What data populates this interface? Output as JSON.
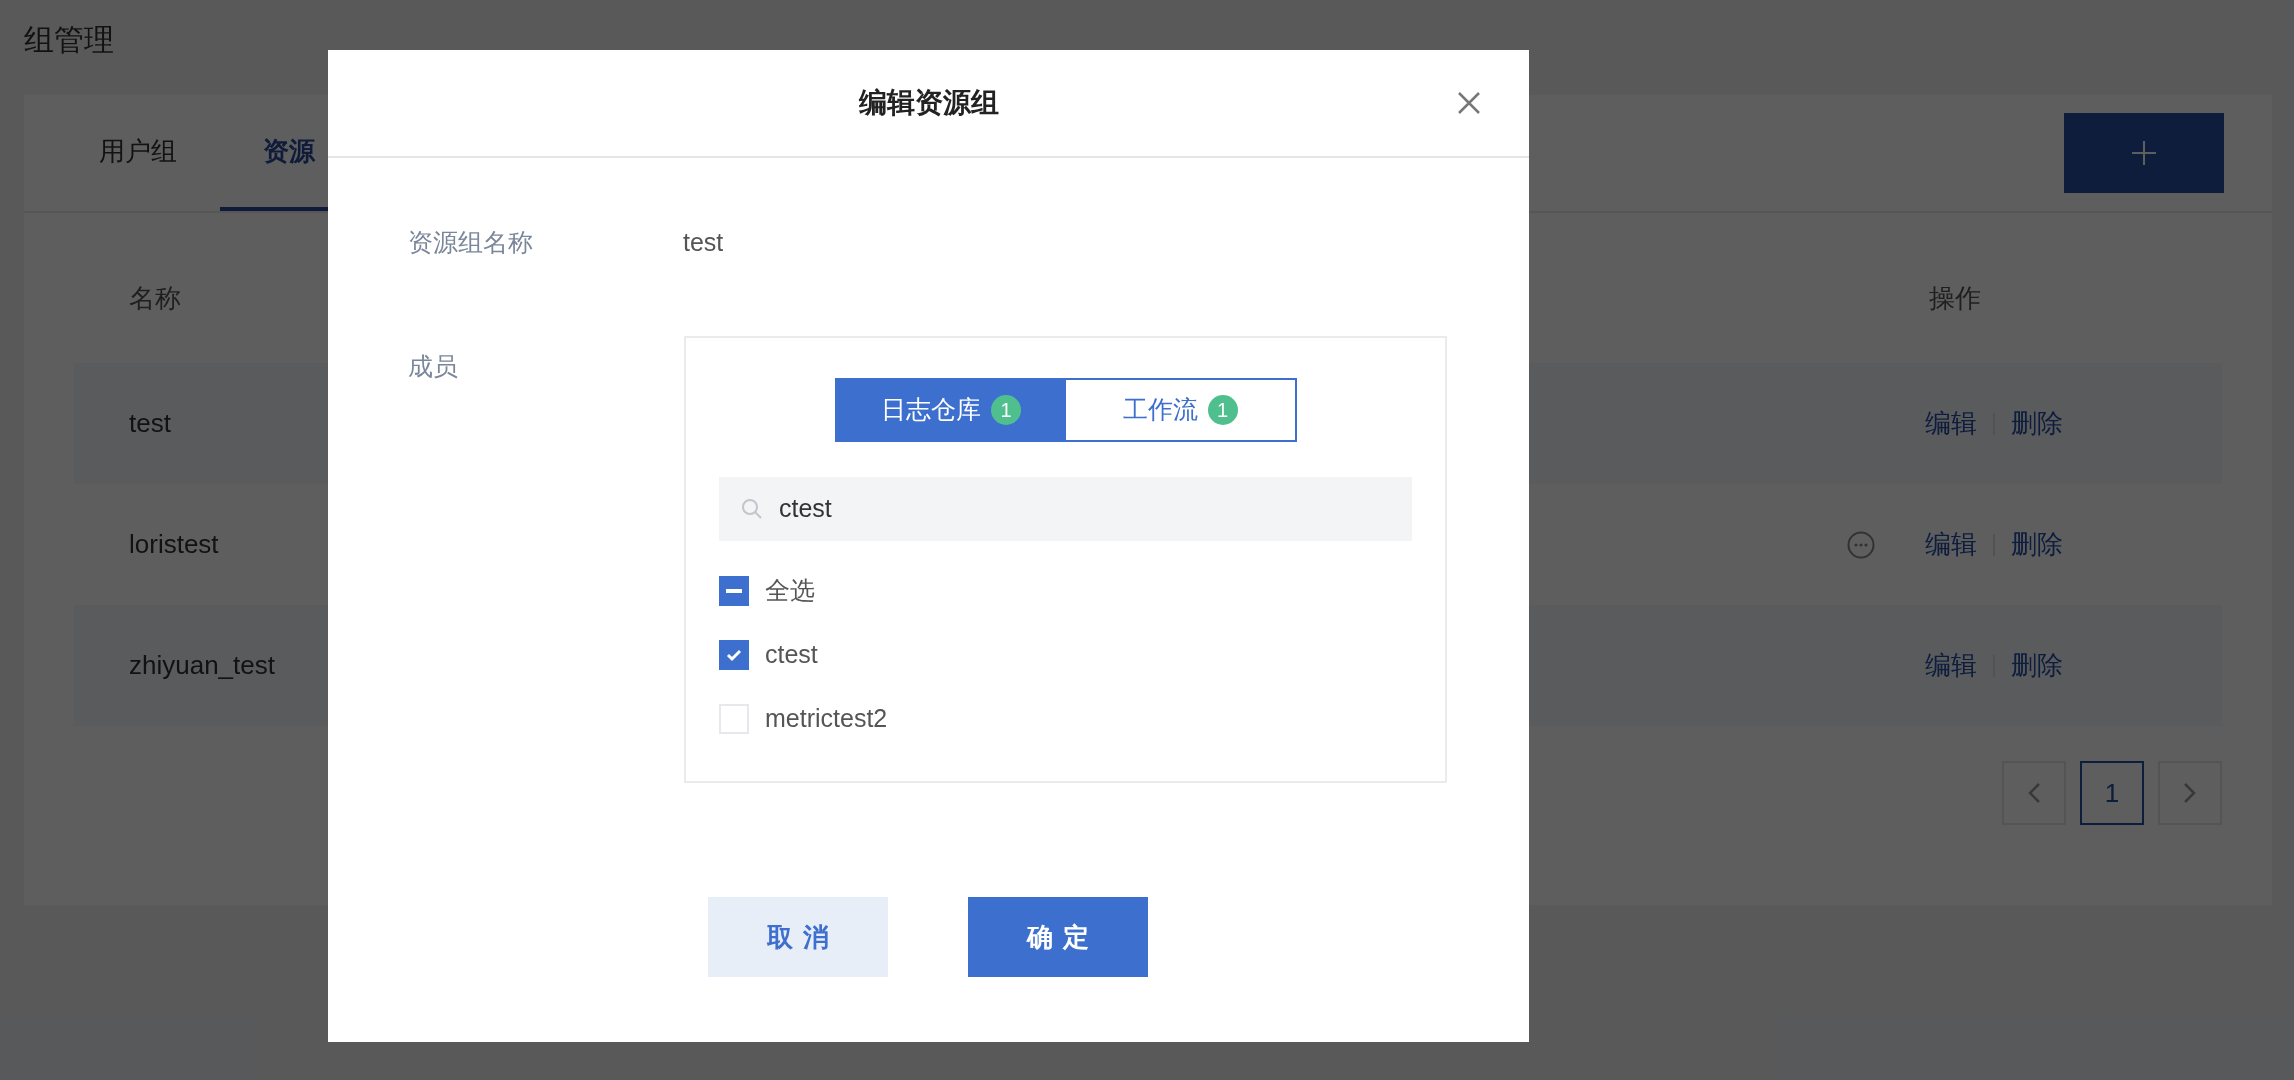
{
  "page_title": "组管理",
  "tabs": [
    {
      "label": "用户组",
      "selected": false
    },
    {
      "label": "资源",
      "selected": true
    }
  ],
  "table": {
    "columns": [
      "名称",
      "操作"
    ],
    "rows": [
      {
        "name": "test",
        "actions": [
          "编辑",
          "删除"
        ],
        "more": false
      },
      {
        "name": "loristest",
        "actions": [
          "编辑",
          "删除"
        ],
        "more": true
      },
      {
        "name": "zhiyuan_test",
        "actions": [
          "编辑",
          "删除"
        ],
        "more": false
      }
    ]
  },
  "pagination": {
    "pages": [
      {
        "label": "1",
        "selected": true
      }
    ]
  },
  "dialog": {
    "title": "编辑资源组",
    "name_field": {
      "label": "资源组名称",
      "value": "test"
    },
    "members": {
      "label": "成员",
      "tabs": [
        {
          "label": "日志仓库",
          "count": "1",
          "selected": true
        },
        {
          "label": "工作流",
          "count": "1",
          "selected": false
        }
      ],
      "search": {
        "value": "ctest"
      },
      "select_all": {
        "label": "全选",
        "indeterminate": true
      },
      "items": [
        {
          "label": "ctest",
          "checked": true
        },
        {
          "label": "metrictest2",
          "checked": false
        }
      ]
    },
    "buttons": [
      {
        "label": "取消",
        "kind": "secondary"
      },
      {
        "label": "确定",
        "kind": "primary"
      }
    ]
  }
}
